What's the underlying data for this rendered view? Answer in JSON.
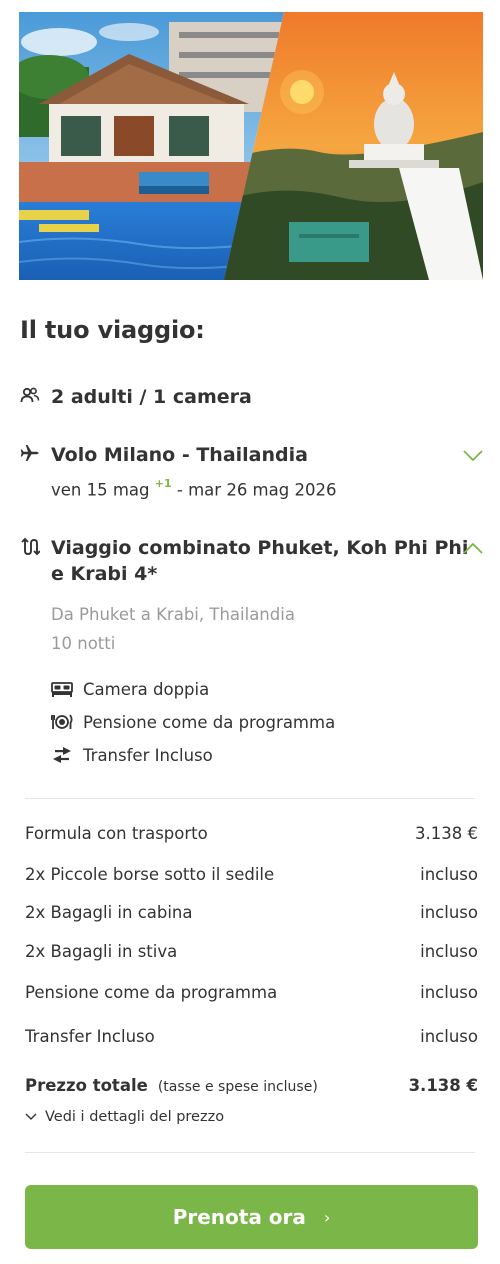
{
  "trip": {
    "title": "Il tuo viaggio:",
    "guests": "2 adulti / 1 camera",
    "flight": {
      "title": "Volo Milano - Thailandia",
      "date_start": "ven 15 mag",
      "plus_days": "+1",
      "date_end": "- mar 26 mag 2026"
    },
    "package": {
      "title_line1": "Viaggio combinato Phuket, Koh Phi Phi",
      "title_line2": "e Krabi 4*",
      "route": "Da Phuket a Krabi, Thailandia",
      "nights": "10 notti",
      "features": [
        {
          "icon": "bed-icon",
          "label": "Camera doppia"
        },
        {
          "icon": "meal-icon",
          "label": "Pensione come da programma"
        },
        {
          "icon": "transfer-icon",
          "label": "Transfer Incluso"
        }
      ]
    }
  },
  "prices": [
    {
      "label": "Formula con trasporto",
      "value": "3.138 €"
    },
    {
      "label": "2x Piccole borse sotto il sedile",
      "value": "incluso"
    },
    {
      "label": "2x Bagagli in cabina",
      "value": "incluso"
    },
    {
      "label": "2x Bagagli in stiva",
      "value": "incluso"
    },
    {
      "label": "Pensione come da programma",
      "value": "incluso"
    },
    {
      "label": "Transfer Incluso",
      "value": "incluso"
    }
  ],
  "total": {
    "label": "Prezzo totale",
    "note": "(tasse e spese incluse)",
    "value": "3.138 €"
  },
  "details_link": "Vedi i dettagli del prezzo",
  "cta": {
    "label": "Prenota ora",
    "chevron": "›"
  },
  "colors": {
    "accent": "#7ab648",
    "text": "#333333",
    "muted": "#9a9a9a"
  },
  "icons": {
    "guests": "people-icon",
    "flight": "plane-icon",
    "package": "route-icon",
    "flight_toggle": "chevron-down-icon",
    "package_toggle": "chevron-up-icon"
  }
}
